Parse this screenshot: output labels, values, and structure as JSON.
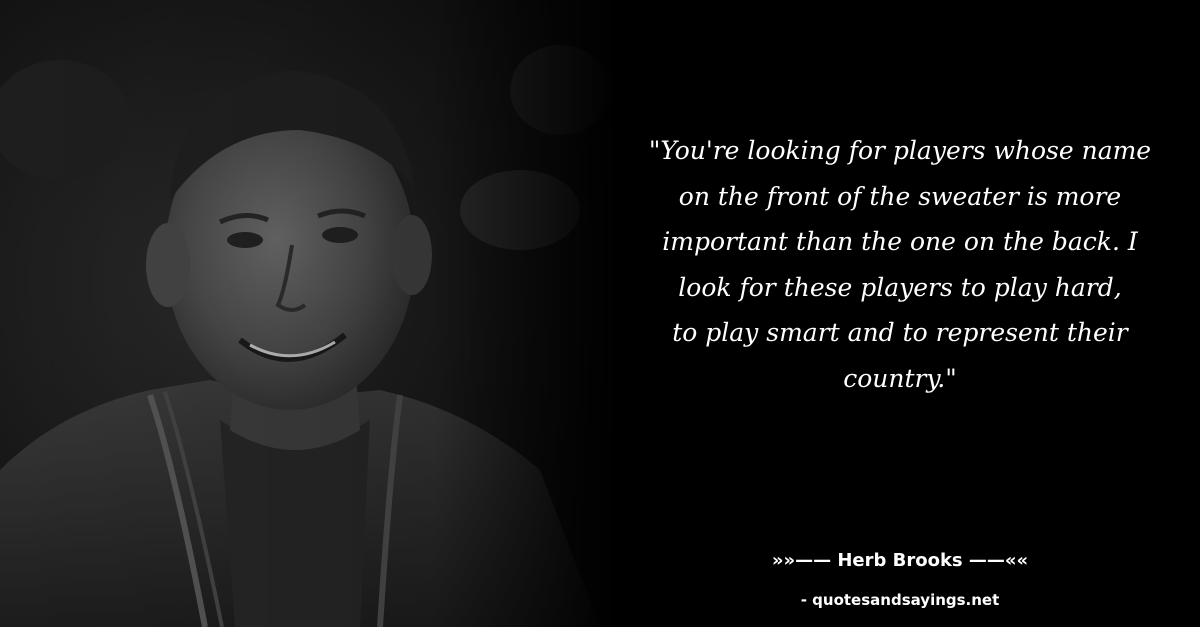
{
  "quote": {
    "lines": [
      "\"You're looking for players whose name",
      "on the front of the sweater is more",
      "important than the one on the back. I",
      "look for these players to play hard,",
      "to play smart and to represent their",
      "country.\""
    ]
  },
  "author": {
    "text": "»»—— Herb Brooks ——««"
  },
  "source": {
    "text": "- quotesandsayings.net"
  },
  "colors": {
    "background": "#000000",
    "text": "#ffffff"
  }
}
